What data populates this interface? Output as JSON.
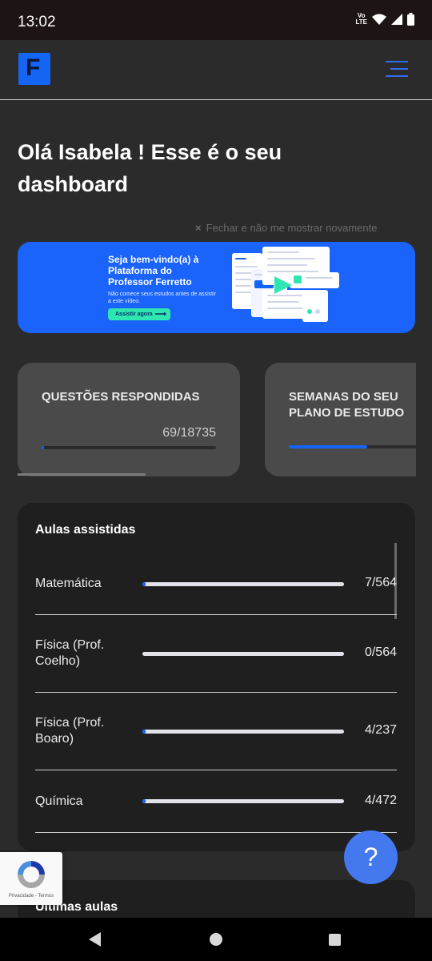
{
  "status_bar": {
    "time": "13:02",
    "volte_top": "Vo",
    "volte_bottom": "LTE"
  },
  "header": {
    "logo_letter": "F"
  },
  "greeting": {
    "title": "Olá Isabela ! Esse é o seu dashboard"
  },
  "dismiss": {
    "icon": "×",
    "label": "Fechar e não me mostrar novamente"
  },
  "banner": {
    "title": "Seja bem-vindo(a) à Plataforma do Professor Ferretto",
    "subtitle": "Não comece seus estudos antes de assistir a este vídeo.",
    "cta_label": "Assistir agora",
    "cta_arrow": "⟶"
  },
  "cards": [
    {
      "label": "QUESTÕES RESPONDIDAS",
      "value": "69/18735",
      "progress": 0.0037
    },
    {
      "label": "SEMANAS DO SEU PLANO DE ESTUDO",
      "progress": 0.45
    }
  ],
  "aulas": {
    "title": "Aulas assistidas",
    "rows": [
      {
        "name": "Matemática",
        "count": "7/564",
        "progress": 0.012
      },
      {
        "name": "Física (Prof. Coelho)",
        "count": "0/564",
        "progress": 0
      },
      {
        "name": "Física (Prof. Boaro)",
        "count": "4/237",
        "progress": 0.017
      },
      {
        "name": "Química",
        "count": "4/472",
        "progress": 0.0085
      }
    ]
  },
  "ultimas": {
    "title": "Últimas aulas"
  },
  "help": {
    "label": "?"
  },
  "recaptcha": {
    "links": "Privacidade - Termos"
  },
  "colors": {
    "accent": "#1565f5",
    "background": "#2b2b2b",
    "card": "#4a4a4a",
    "panel": "#1f1f1f",
    "cta": "#2ee6b0"
  }
}
